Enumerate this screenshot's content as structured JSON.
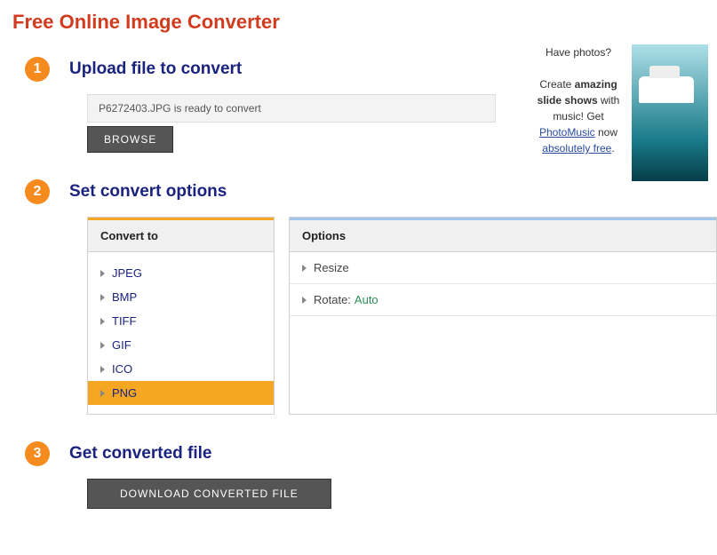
{
  "page": {
    "title": "Free Online Image Converter"
  },
  "steps": {
    "s1": {
      "num": "1",
      "title": "Upload file to convert"
    },
    "s2": {
      "num": "2",
      "title": "Set convert options"
    },
    "s3": {
      "num": "3",
      "title": "Get converted file"
    }
  },
  "upload": {
    "file_status": "P6272403.JPG is ready to convert",
    "browse_label": "BROWSE"
  },
  "convert": {
    "panel_title": "Convert to",
    "formats": [
      "JPEG",
      "BMP",
      "TIFF",
      "GIF",
      "ICO",
      "PNG"
    ],
    "selected_index": 5
  },
  "options": {
    "panel_title": "Options",
    "items": [
      {
        "label": "Resize",
        "value": ""
      },
      {
        "label": "Rotate:",
        "value": "Auto"
      }
    ]
  },
  "download": {
    "button_label": "DOWNLOAD CONVERTED FILE"
  },
  "promo": {
    "line1": "Have photos?",
    "line2a": "Create ",
    "line2b": "amazing slide shows",
    "line2c": " with music! Get ",
    "link1": "PhotoMusic",
    "line3": " now ",
    "link2": "absolutely free",
    "tail": "."
  }
}
